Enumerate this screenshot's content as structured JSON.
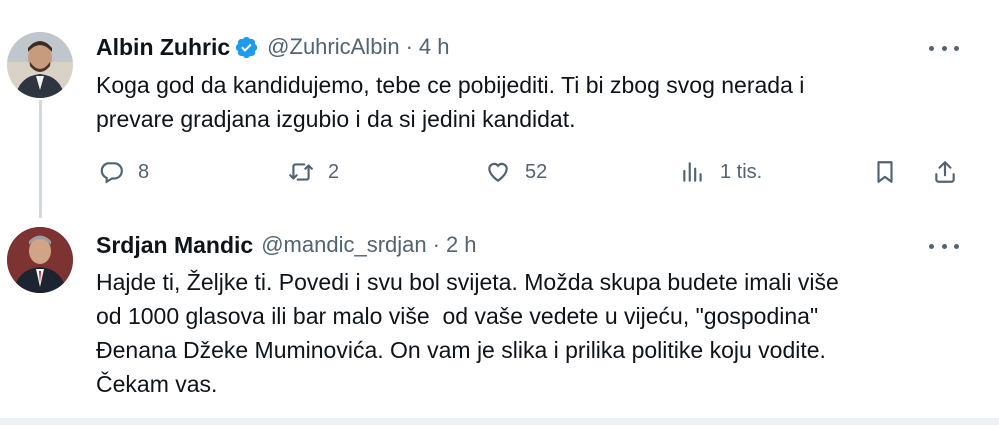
{
  "tweets": [
    {
      "name": "Albin Zuhric",
      "verified": true,
      "handle": "@ZuhricAlbin",
      "separator": "·",
      "time": "4 h",
      "text": "Koga god da kandidujemo, tebe ce pobijediti. Ti bi zbog svog nerada i\nprevare gradjana izgubio i da si jedini kandidat.",
      "actions": {
        "reply_count": "8",
        "retweet_count": "2",
        "like_count": "52",
        "views_count": "1 tis."
      }
    },
    {
      "name": "Srdjan Mandic",
      "verified": false,
      "handle": "@mandic_srdjan",
      "separator": "·",
      "time": "2 h",
      "text": "Hajde ti, Željke ti. Povedi i svu bol svijeta. Možda skupa budete imali više\nod 1000 glasova ili bar malo više  od vaše vedete u vijeću, \"gospodina\"\nĐenana Džeke Muminovića. On vam je slika i prilika politike koju vodite.\nČekam vas."
    }
  ],
  "colors": {
    "text": "#0f1419",
    "muted": "#536471",
    "verified": "#1d9bf0",
    "thread_line": "#cfd9de"
  }
}
